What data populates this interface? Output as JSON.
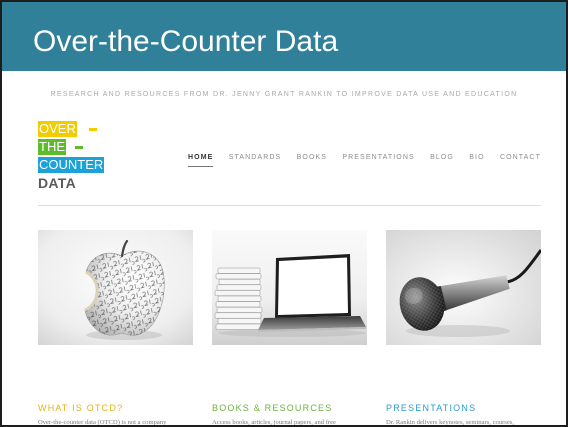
{
  "slide": {
    "title": "Over-the-Counter Data",
    "header_color": "#31809a"
  },
  "site": {
    "tagline": "RESEARCH AND RESOURCES FROM DR. JENNY GRANT RANKIN TO IMPROVE DATA USE AND EDUCATION",
    "logo": {
      "line_1": "OVER",
      "line_2": "THE",
      "line_3": "COUNTER",
      "line_4": "DATA",
      "color_1": "#f1cd00",
      "color_2": "#5dbb2c",
      "color_3": "#1ba2d9",
      "color_4": "#5b5b5b"
    },
    "nav": [
      {
        "label": "HOME",
        "active": true
      },
      {
        "label": "STANDARDS",
        "active": false
      },
      {
        "label": "BOOKS",
        "active": false
      },
      {
        "label": "PRESENTATIONS",
        "active": false
      },
      {
        "label": "BLOG",
        "active": false
      },
      {
        "label": "BIO",
        "active": false
      },
      {
        "label": "CONTACT",
        "active": false
      }
    ],
    "features": [
      {
        "heading": "WHAT IS OTCD?",
        "color": "#e6b313",
        "excerpt": "Over-the-counter data (OTCD) is not a company"
      },
      {
        "heading": "BOOKS & RESOURCES",
        "color": "#6cb33e",
        "excerpt": "Access books, articles, journal papers, and free"
      },
      {
        "heading": "PRESENTATIONS",
        "color": "#2a9bd5",
        "excerpt": "Dr. Rankin delivers keynotes, seminars, courses,"
      }
    ]
  }
}
